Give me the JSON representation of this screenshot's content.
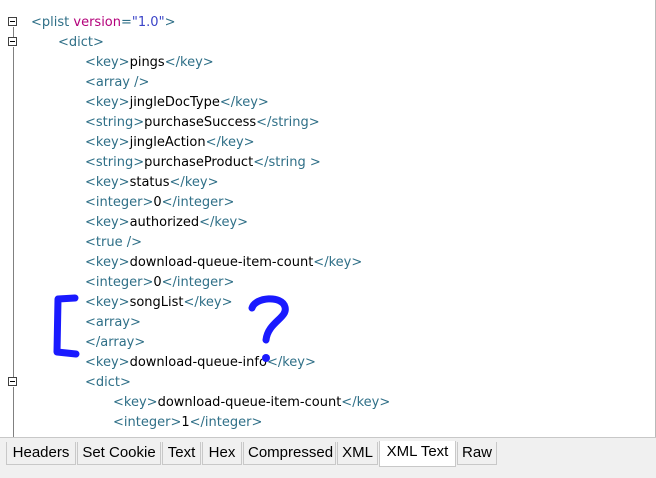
{
  "editor": {
    "lines": [
      {
        "indent": 0,
        "parts": [
          [
            "tag",
            "<"
          ],
          [
            "tag",
            "plist "
          ],
          [
            "attr",
            "version"
          ],
          [
            "tag",
            "="
          ],
          [
            "val",
            "\"1.0\""
          ],
          [
            "tag",
            ">"
          ]
        ]
      },
      {
        "indent": 1,
        "parts": [
          [
            "tag",
            "<"
          ],
          [
            "tag",
            "dict"
          ],
          [
            "tag",
            ">"
          ]
        ]
      },
      {
        "indent": 2,
        "parts": [
          [
            "tag",
            "<"
          ],
          [
            "tag",
            "key"
          ],
          [
            "tag",
            ">"
          ],
          [
            "txt",
            "pings"
          ],
          [
            "tag",
            "</"
          ],
          [
            "tag",
            "key"
          ],
          [
            "tag",
            ">"
          ]
        ]
      },
      {
        "indent": 2,
        "parts": [
          [
            "tag",
            "<"
          ],
          [
            "tag",
            "array "
          ],
          [
            "tag",
            "/>"
          ]
        ]
      },
      {
        "indent": 2,
        "parts": [
          [
            "tag",
            "<"
          ],
          [
            "tag",
            "key"
          ],
          [
            "tag",
            ">"
          ],
          [
            "txt",
            "jingleDocType"
          ],
          [
            "tag",
            "</"
          ],
          [
            "tag",
            "key"
          ],
          [
            "tag",
            ">"
          ]
        ]
      },
      {
        "indent": 2,
        "parts": [
          [
            "tag",
            "<"
          ],
          [
            "tag",
            "string"
          ],
          [
            "tag",
            ">"
          ],
          [
            "txt",
            "purchaseSuccess"
          ],
          [
            "tag",
            "</"
          ],
          [
            "tag",
            "string"
          ],
          [
            "tag",
            ">"
          ]
        ]
      },
      {
        "indent": 2,
        "parts": [
          [
            "tag",
            "<"
          ],
          [
            "tag",
            "key"
          ],
          [
            "tag",
            ">"
          ],
          [
            "txt",
            "jingleAction"
          ],
          [
            "tag",
            "</"
          ],
          [
            "tag",
            "key"
          ],
          [
            "tag",
            ">"
          ]
        ]
      },
      {
        "indent": 2,
        "parts": [
          [
            "tag",
            "<"
          ],
          [
            "tag",
            "string"
          ],
          [
            "tag",
            ">"
          ],
          [
            "txt",
            "purchaseProduct"
          ],
          [
            "tag",
            "</"
          ],
          [
            "tag",
            "string"
          ],
          [
            "tag",
            " >"
          ]
        ]
      },
      {
        "indent": 2,
        "parts": [
          [
            "tag",
            "<"
          ],
          [
            "tag",
            "key"
          ],
          [
            "tag",
            ">"
          ],
          [
            "txt",
            "status"
          ],
          [
            "tag",
            "</"
          ],
          [
            "tag",
            "key"
          ],
          [
            "tag",
            ">"
          ]
        ]
      },
      {
        "indent": 2,
        "parts": [
          [
            "tag",
            "<"
          ],
          [
            "tag",
            "integer"
          ],
          [
            "tag",
            ">"
          ],
          [
            "txt",
            "0"
          ],
          [
            "tag",
            "</"
          ],
          [
            "tag",
            "integer"
          ],
          [
            "tag",
            ">"
          ]
        ]
      },
      {
        "indent": 2,
        "parts": [
          [
            "tag",
            "<"
          ],
          [
            "tag",
            "key"
          ],
          [
            "tag",
            ">"
          ],
          [
            "txt",
            "authorized"
          ],
          [
            "tag",
            "</"
          ],
          [
            "tag",
            "key"
          ],
          [
            "tag",
            ">"
          ]
        ]
      },
      {
        "indent": 2,
        "parts": [
          [
            "tag",
            "<"
          ],
          [
            "tag",
            "true "
          ],
          [
            "tag",
            "/>"
          ]
        ]
      },
      {
        "indent": 2,
        "parts": [
          [
            "tag",
            "<"
          ],
          [
            "tag",
            "key"
          ],
          [
            "tag",
            ">"
          ],
          [
            "txt",
            "download-queue-item-count"
          ],
          [
            "tag",
            "</"
          ],
          [
            "tag",
            "key"
          ],
          [
            "tag",
            ">"
          ]
        ]
      },
      {
        "indent": 2,
        "parts": [
          [
            "tag",
            "<"
          ],
          [
            "tag",
            "integer"
          ],
          [
            "tag",
            ">"
          ],
          [
            "txt",
            "0"
          ],
          [
            "tag",
            "</"
          ],
          [
            "tag",
            "integer"
          ],
          [
            "tag",
            ">"
          ]
        ]
      },
      {
        "indent": 2,
        "parts": [
          [
            "tag",
            "<"
          ],
          [
            "tag",
            "key"
          ],
          [
            "tag",
            ">"
          ],
          [
            "txt",
            "songList"
          ],
          [
            "tag",
            "</"
          ],
          [
            "tag",
            "key"
          ],
          [
            "tag",
            ">"
          ]
        ]
      },
      {
        "indent": 2,
        "parts": [
          [
            "tag",
            "<"
          ],
          [
            "tag",
            "array"
          ],
          [
            "tag",
            ">"
          ]
        ]
      },
      {
        "indent": 2,
        "parts": [
          [
            "tag",
            "</"
          ],
          [
            "tag",
            "array"
          ],
          [
            "tag",
            ">"
          ]
        ]
      },
      {
        "indent": 2,
        "parts": [
          [
            "tag",
            "<"
          ],
          [
            "tag",
            "key"
          ],
          [
            "tag",
            ">"
          ],
          [
            "txt",
            "download-queue-info"
          ],
          [
            "tag",
            "</"
          ],
          [
            "tag",
            "key"
          ],
          [
            "tag",
            ">"
          ]
        ]
      },
      {
        "indent": 2,
        "parts": [
          [
            "tag",
            "<"
          ],
          [
            "tag",
            "dict"
          ],
          [
            "tag",
            ">"
          ]
        ]
      },
      {
        "indent": 3,
        "parts": [
          [
            "tag",
            "<"
          ],
          [
            "tag",
            "key"
          ],
          [
            "tag",
            ">"
          ],
          [
            "txt",
            "download-queue-item-count"
          ],
          [
            "tag",
            "</"
          ],
          [
            "tag",
            "key"
          ],
          [
            "tag",
            ">"
          ]
        ]
      },
      {
        "indent": 3,
        "parts": [
          [
            "tag",
            "<"
          ],
          [
            "tag",
            "integer"
          ],
          [
            "tag",
            ">"
          ],
          [
            "txt",
            "1"
          ],
          [
            "tag",
            "</"
          ],
          [
            "tag",
            "integer"
          ],
          [
            "tag",
            ">"
          ]
        ]
      }
    ]
  },
  "tabs": [
    {
      "label": "Headers",
      "active": false
    },
    {
      "label": "Set Cookie",
      "active": false
    },
    {
      "label": "Text",
      "active": false
    },
    {
      "label": "Hex",
      "active": false
    },
    {
      "label": "Compressed",
      "active": false
    },
    {
      "label": "XML",
      "active": false
    },
    {
      "label": "XML Text",
      "active": true
    },
    {
      "label": "Raw",
      "active": false
    }
  ],
  "colors": {
    "tag": "#2f6f87",
    "attribute": "#b3007a",
    "value": "#3b44c8",
    "annotation": "#1a1aff"
  }
}
